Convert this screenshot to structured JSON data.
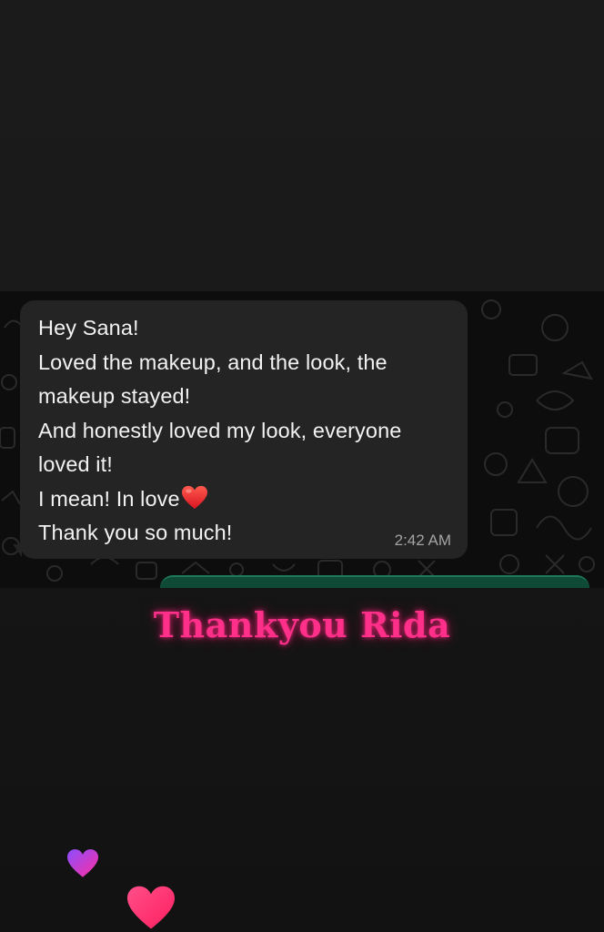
{
  "message": {
    "lines": [
      "Hey Sana!",
      "Loved the makeup, and the look, the",
      "makeup stayed!",
      "And honestly loved my look, everyone",
      "loved it!",
      "I mean! In love",
      "Thank you so much!"
    ],
    "emoji": "red-heart-icon",
    "time": "2:42 AM"
  },
  "caption": "Thankyou Rida",
  "colors": {
    "bubble": "#242424",
    "caption": "#ff2f8a",
    "outgoing_bubble": "#0f4a36"
  }
}
